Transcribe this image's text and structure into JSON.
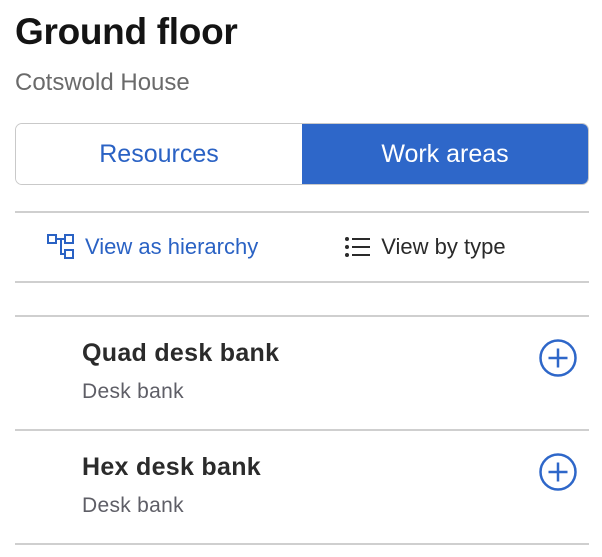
{
  "header": {
    "title": "Ground floor",
    "subtitle": "Cotswold House"
  },
  "tabs": [
    {
      "label": "Resources",
      "active": false
    },
    {
      "label": "Work areas",
      "active": true
    }
  ],
  "view_options": {
    "hierarchy_label": "View as hierarchy",
    "hierarchy_icon": "hierarchy-icon",
    "by_type_label": "View by type",
    "by_type_icon": "list-icon"
  },
  "items": [
    {
      "name": "Quad desk bank",
      "type": "Desk bank",
      "action_icon": "plus-circle-icon"
    },
    {
      "name": "Hex desk bank",
      "type": "Desk bank",
      "action_icon": "plus-circle-icon"
    }
  ],
  "colors": {
    "accent": "#2e67c9",
    "link": "#2a62c4",
    "divider": "#cfcfcf"
  }
}
